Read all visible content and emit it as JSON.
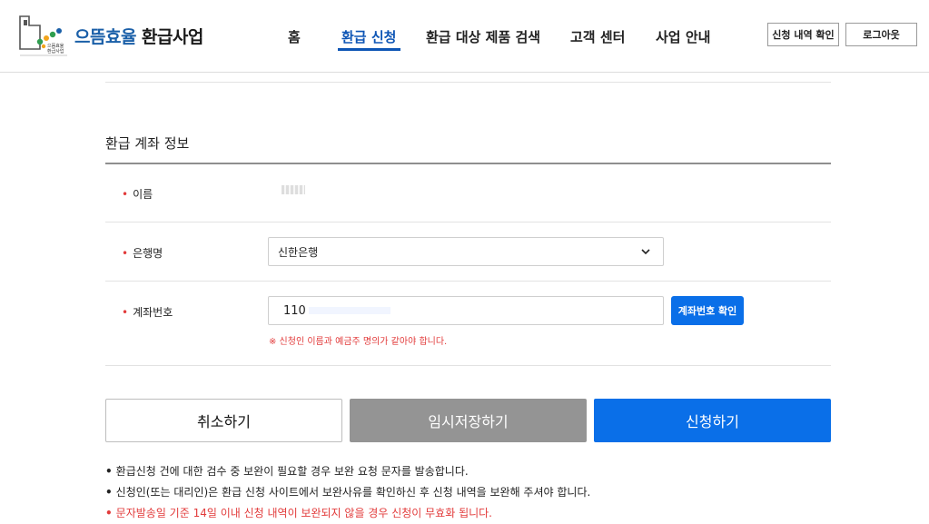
{
  "header": {
    "logo_text_primary": "으뜸효율",
    "logo_text_secondary": "환급사업",
    "logo_mark_text": "으뜸효율 환급사업",
    "nav": [
      {
        "label": "홈",
        "active": false
      },
      {
        "label": "환급 신청",
        "active": true
      },
      {
        "label": "환급 대상 제품 검색",
        "active": false
      },
      {
        "label": "고객 센터",
        "active": false
      },
      {
        "label": "사업 안내",
        "active": false
      }
    ],
    "check_history_label": "신청 내역 확인",
    "logout_label": "로그아웃",
    "accent_color": "#0d55b5"
  },
  "form": {
    "section_title": "환급 계좌 정보",
    "required_mark": "•",
    "name_label": "이름",
    "bank_label": "은행명",
    "bank_value": "신한은행",
    "account_label": "계좌번호",
    "account_value": "110",
    "verify_button": "계좌번호 확인",
    "warning": "※ 신청인 이름과 예금주 명의가 같아야 합니다."
  },
  "actions": {
    "cancel": "취소하기",
    "temp_save": "임시저장하기",
    "submit": "신청하기",
    "primary_color": "#0a6fe8",
    "disabled_color": "#949494"
  },
  "notices": [
    {
      "text": "환급신청 건에 대한 검수 중 보완이 필요할 경우 보완 요청 문자를 발송합니다.",
      "highlight": false
    },
    {
      "text": "신청인(또는 대리인)은 환급 신청 사이트에서 보완사유를 확인하신 후 신청 내역을 보완해 주셔야 합니다.",
      "highlight": false
    },
    {
      "text": "문자발송일 기준 14일 이내 신청 내역이 보완되지 않을 경우 신청이 무효화 됩니다.",
      "highlight": true
    }
  ],
  "bullet": "•"
}
